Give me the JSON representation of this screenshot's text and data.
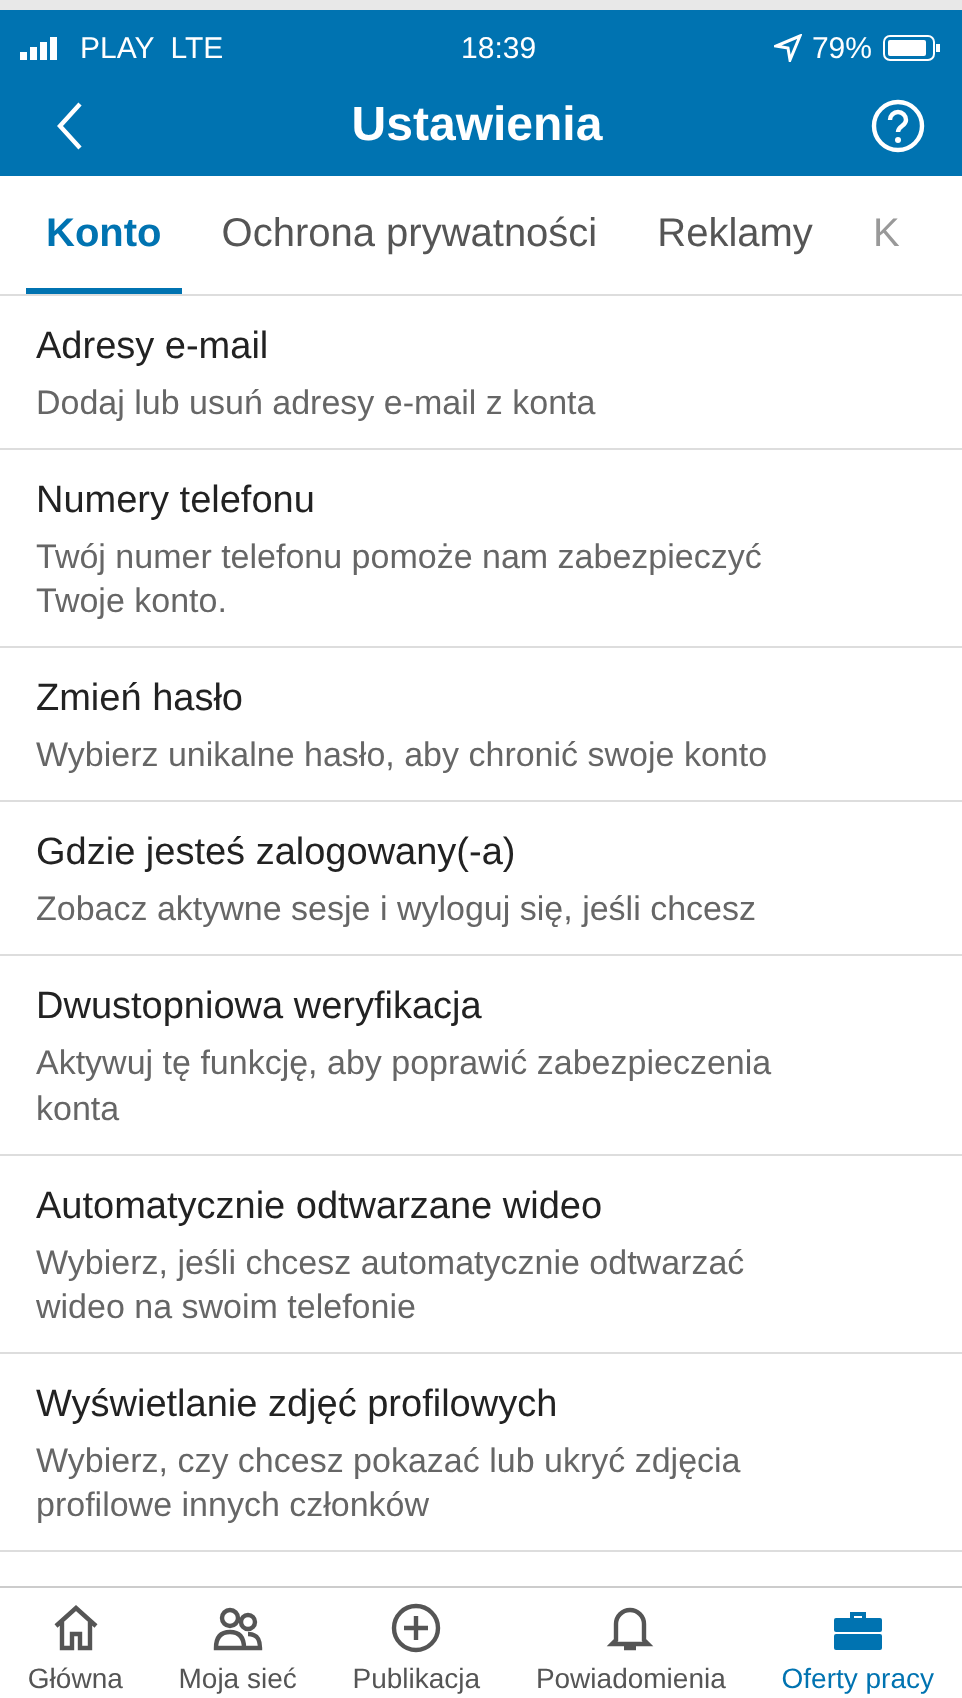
{
  "status_bar": {
    "carrier": "PLAY",
    "network": "LTE",
    "time": "18:39",
    "battery": "79%"
  },
  "header": {
    "title": "Ustawienia"
  },
  "tabs": [
    {
      "label": "Konto",
      "selected": true
    },
    {
      "label": "Ochrona prywatności",
      "selected": false
    },
    {
      "label": "Reklamy",
      "selected": false
    },
    {
      "label": "K",
      "selected": false
    }
  ],
  "settings": [
    {
      "title": "Adresy e-mail",
      "description": "Dodaj lub usuń adresy e-mail z konta"
    },
    {
      "title": "Numery telefonu",
      "description": "Twój numer telefonu pomoże nam zabezpieczyć Twoje konto."
    },
    {
      "title": "Zmień hasło",
      "description": "Wybierz unikalne hasło, aby chronić swoje konto"
    },
    {
      "title": "Gdzie jesteś zalogowany(-a)",
      "description": "Zobacz aktywne sesje i wyloguj się, jeśli chcesz"
    },
    {
      "title": "Dwustopniowa weryfikacja",
      "description": "Aktywuj tę funkcję, aby poprawić zabezpieczenia konta"
    },
    {
      "title": "Automatycznie odtwarzane wideo",
      "description": "Wybierz, jeśli chcesz automatycznie odtwarzać wideo na swoim telefonie"
    },
    {
      "title": "Wyświetlanie zdjęć profilowych",
      "description": "Wybierz, czy chcesz pokazać lub ukryć zdjęcia profilowe innych członków"
    }
  ],
  "bottom_nav": [
    {
      "kind": "home",
      "label": "Główna",
      "selected": false
    },
    {
      "kind": "network",
      "label": "Moja sieć",
      "selected": false
    },
    {
      "kind": "post",
      "label": "Publikacja",
      "selected": false
    },
    {
      "kind": "notifications",
      "label": "Powiadomienia",
      "selected": false
    },
    {
      "kind": "jobs",
      "label": "Oferty pracy",
      "selected": true
    }
  ]
}
